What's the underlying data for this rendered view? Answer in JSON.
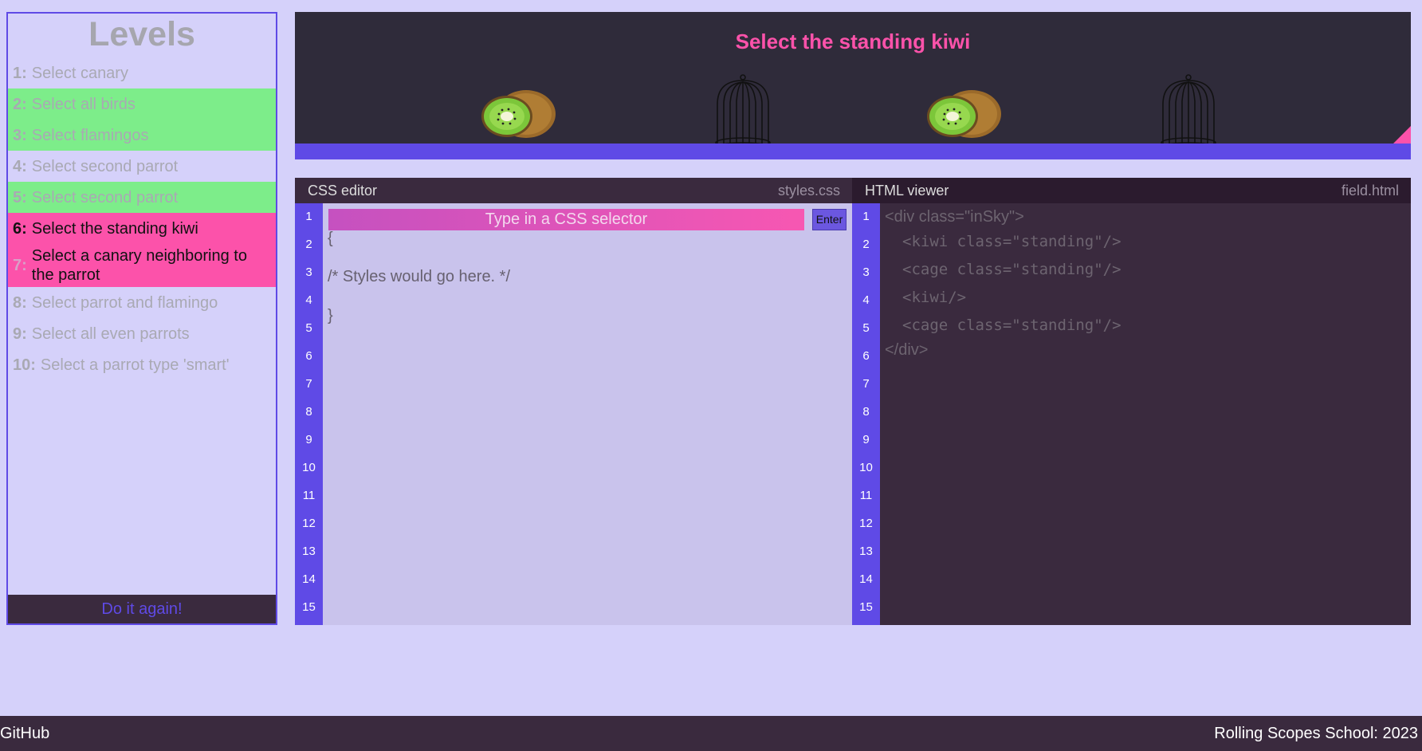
{
  "sidebar": {
    "title": "Levels",
    "levels": [
      {
        "num": "1:",
        "label": "Select canary",
        "state": "normal"
      },
      {
        "num": "2:",
        "label": "Select all birds",
        "state": "done"
      },
      {
        "num": "3:",
        "label": "Select flamingos",
        "state": "done"
      },
      {
        "num": "4:",
        "label": "Select second parrot",
        "state": "normal"
      },
      {
        "num": "5:",
        "label": "Select second parrot",
        "state": "done"
      },
      {
        "num": "6:",
        "label": "Select the standing kiwi",
        "state": "current"
      },
      {
        "num": "7:",
        "label": "Select a canary neighboring to the parrot",
        "state": "pending"
      },
      {
        "num": "8:",
        "label": "Select parrot and flamingo",
        "state": "normal"
      },
      {
        "num": "9:",
        "label": "Select all even parrots",
        "state": "normal"
      },
      {
        "num": "10:",
        "label": "Select a parrot type 'smart'",
        "state": "normal"
      }
    ],
    "do_again": "Do it again!"
  },
  "field": {
    "task": "Select the standing kiwi",
    "items": [
      "kiwi-icon",
      "cage-icon",
      "kiwi-icon",
      "cage-icon"
    ]
  },
  "css_editor": {
    "title": "CSS editor",
    "filename": "styles.css",
    "placeholder": "Type in a CSS selector",
    "enter": "Enter",
    "line_open": "{",
    "comment": "/* Styles would go here. */",
    "line_close": "}",
    "line_numbers": [
      "1",
      "2",
      "3",
      "4",
      "5",
      "6",
      "7",
      "8",
      "9",
      "10",
      "11",
      "12",
      "13",
      "14",
      "15"
    ]
  },
  "html_viewer": {
    "title": "HTML viewer",
    "filename": "field.html",
    "lines": [
      "<div class=\"inSky\">",
      "<kiwi class=\"standing\"/>",
      "<cage class=\"standing\"/>",
      "<kiwi/>",
      "<cage class=\"standing\"/>",
      "</div>"
    ],
    "line_numbers": [
      "1",
      "2",
      "3",
      "4",
      "5",
      "6",
      "7",
      "8",
      "9",
      "10",
      "11",
      "12",
      "13",
      "14",
      "15"
    ]
  },
  "footer": {
    "left": "GitHub",
    "right": "Rolling Scopes School: 2023"
  },
  "colors": {
    "background": "#d5d1fa",
    "accent": "#5f4ae6",
    "pink": "#fc52aa",
    "done": "#7ded8a",
    "dark": "#3a2a3e"
  }
}
